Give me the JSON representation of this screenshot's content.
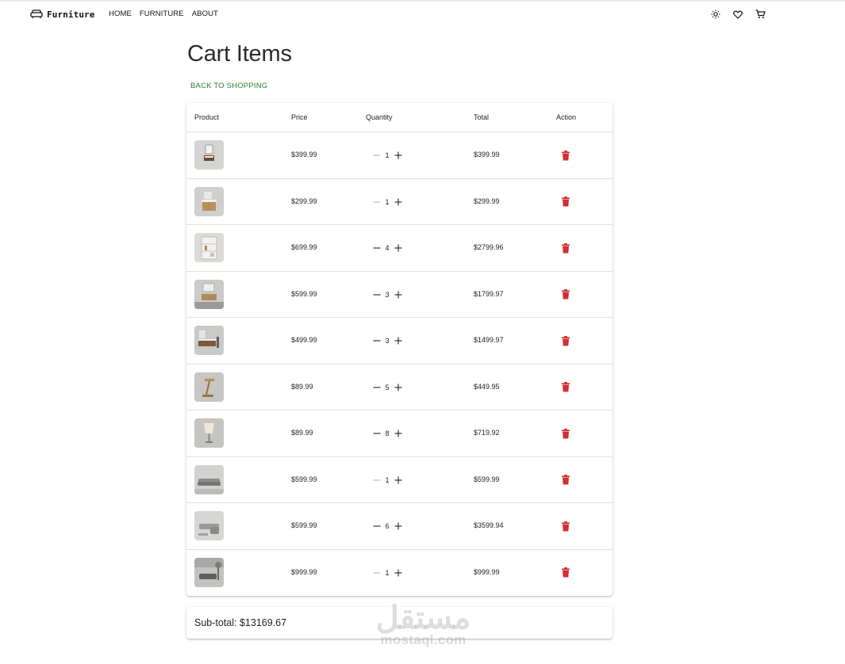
{
  "brand": {
    "name": "Furniture",
    "icon": "sofa-icon"
  },
  "nav": [
    {
      "label": "HOME"
    },
    {
      "label": "FURNITURE"
    },
    {
      "label": "ABOUT"
    }
  ],
  "header_icons": [
    "theme-toggle-icon",
    "heart-icon",
    "cart-icon"
  ],
  "page": {
    "title": "Cart Items",
    "back_link": "BACK TO SHOPPING"
  },
  "table": {
    "headers": {
      "product": "Product",
      "price": "Price",
      "quantity": "Quantity",
      "total": "Total",
      "action": "Action"
    },
    "rows": [
      {
        "thumb": "wall-mirror-vanity",
        "price": "$399.99",
        "qty": "1",
        "total": "$399.99"
      },
      {
        "thumb": "wood-vanity-cabinet",
        "price": "$299.99",
        "qty": "1",
        "total": "$299.99"
      },
      {
        "thumb": "white-shelf-vanity",
        "price": "$699.99",
        "qty": "4",
        "total": "$2799.96"
      },
      {
        "thumb": "floating-vanity-mirror",
        "price": "$599.99",
        "qty": "3",
        "total": "$1799.97"
      },
      {
        "thumb": "modern-vanity",
        "price": "$499.99",
        "qty": "3",
        "total": "$1499.97"
      },
      {
        "thumb": "wood-desk-lamp",
        "price": "$89.99",
        "qty": "5",
        "total": "$449.95"
      },
      {
        "thumb": "table-lamp",
        "price": "$89.99",
        "qty": "8",
        "total": "$719.92"
      },
      {
        "thumb": "grey-sofa",
        "price": "$599.99",
        "qty": "1",
        "total": "$599.99"
      },
      {
        "thumb": "sectional-sofa",
        "price": "$599.99",
        "qty": "6",
        "total": "$3599.94"
      },
      {
        "thumb": "living-room-sofa",
        "price": "$999.99",
        "qty": "1",
        "total": "$999.99"
      }
    ]
  },
  "subtotal": {
    "text": "Sub-total: $13169.67"
  },
  "watermark": {
    "arabic": "مستقل",
    "latin": "mostaql.com"
  },
  "colors": {
    "accent_link": "#2e7d32",
    "delete": "#d32f2f",
    "title": "#2b2b2b"
  }
}
